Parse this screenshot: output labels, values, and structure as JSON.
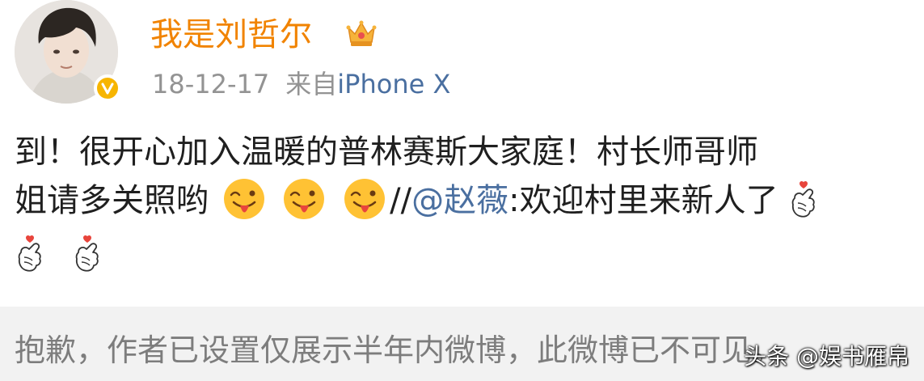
{
  "post": {
    "username": "我是刘哲尔",
    "date": "18-12-17",
    "source_prefix": "来自",
    "device": "iPhone X",
    "body_line1": "到！很开心加入温暖的普林赛斯大家庭！村长师哥师",
    "body_line2_start": "姐请多关照哟",
    "repost_slashes": "//",
    "mention": "@赵薇",
    "repost_text": ":欢迎村里来新人了"
  },
  "notice": {
    "text": "抱歉，作者已设置仅展示半年内微博，此微博已不可见。"
  },
  "watermark": {
    "text": "头条 @娱书雁帛"
  },
  "colors": {
    "username": "#f18300",
    "link": "#4a6fa0",
    "meta": "#939393",
    "notice_bg": "#f2f2f2",
    "notice_text": "#7d7d7d",
    "badge": "#f7b500"
  },
  "icons": {
    "badge": "verified-badge-icon",
    "crown": "crown-icon",
    "emoji": "tongue-out-emoji-icon",
    "heart": "finger-heart-icon"
  }
}
